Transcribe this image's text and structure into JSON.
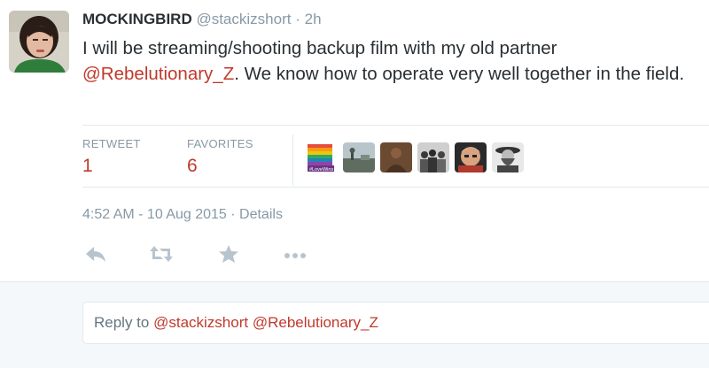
{
  "tweet": {
    "author_name": "MOCKINGBIRD",
    "handle": "@stackizshort",
    "separator": "·",
    "time_ago": "2h",
    "text_part1": "I will be streaming/shooting backup film with my old partner",
    "mention": "@Rebelutionary_Z",
    "text_part2": ". We know how to operate very well together in the field."
  },
  "stats": {
    "retweets_label": "RETWEET",
    "retweets_value": "1",
    "favorites_label": "FAVORITES",
    "favorites_value": "6"
  },
  "favoriters": [
    {
      "icon": "rainbow-flag-avatar",
      "overlay": "#LoveWins"
    },
    {
      "icon": "landscape-avatar"
    },
    {
      "icon": "brown-figure-avatar"
    },
    {
      "icon": "group-photo-avatar"
    },
    {
      "icon": "face-avatar"
    },
    {
      "icon": "sketch-portrait-avatar"
    }
  ],
  "meta": {
    "timestamp": "4:52 AM - 10 Aug 2015",
    "separator": "·",
    "details_label": "Details"
  },
  "actions": [
    "reply-icon",
    "retweet-icon",
    "favorite-icon",
    "more-icon"
  ],
  "reply": {
    "prefix": "Reply to ",
    "mention1": "@stackizshort",
    "mention2": "@Rebelutionary_Z"
  },
  "colors": {
    "accent": "#c0392b",
    "muted": "#8899a6",
    "text": "#292f33",
    "border": "#e1e8ed",
    "reply_bg": "#f5f8fa"
  }
}
